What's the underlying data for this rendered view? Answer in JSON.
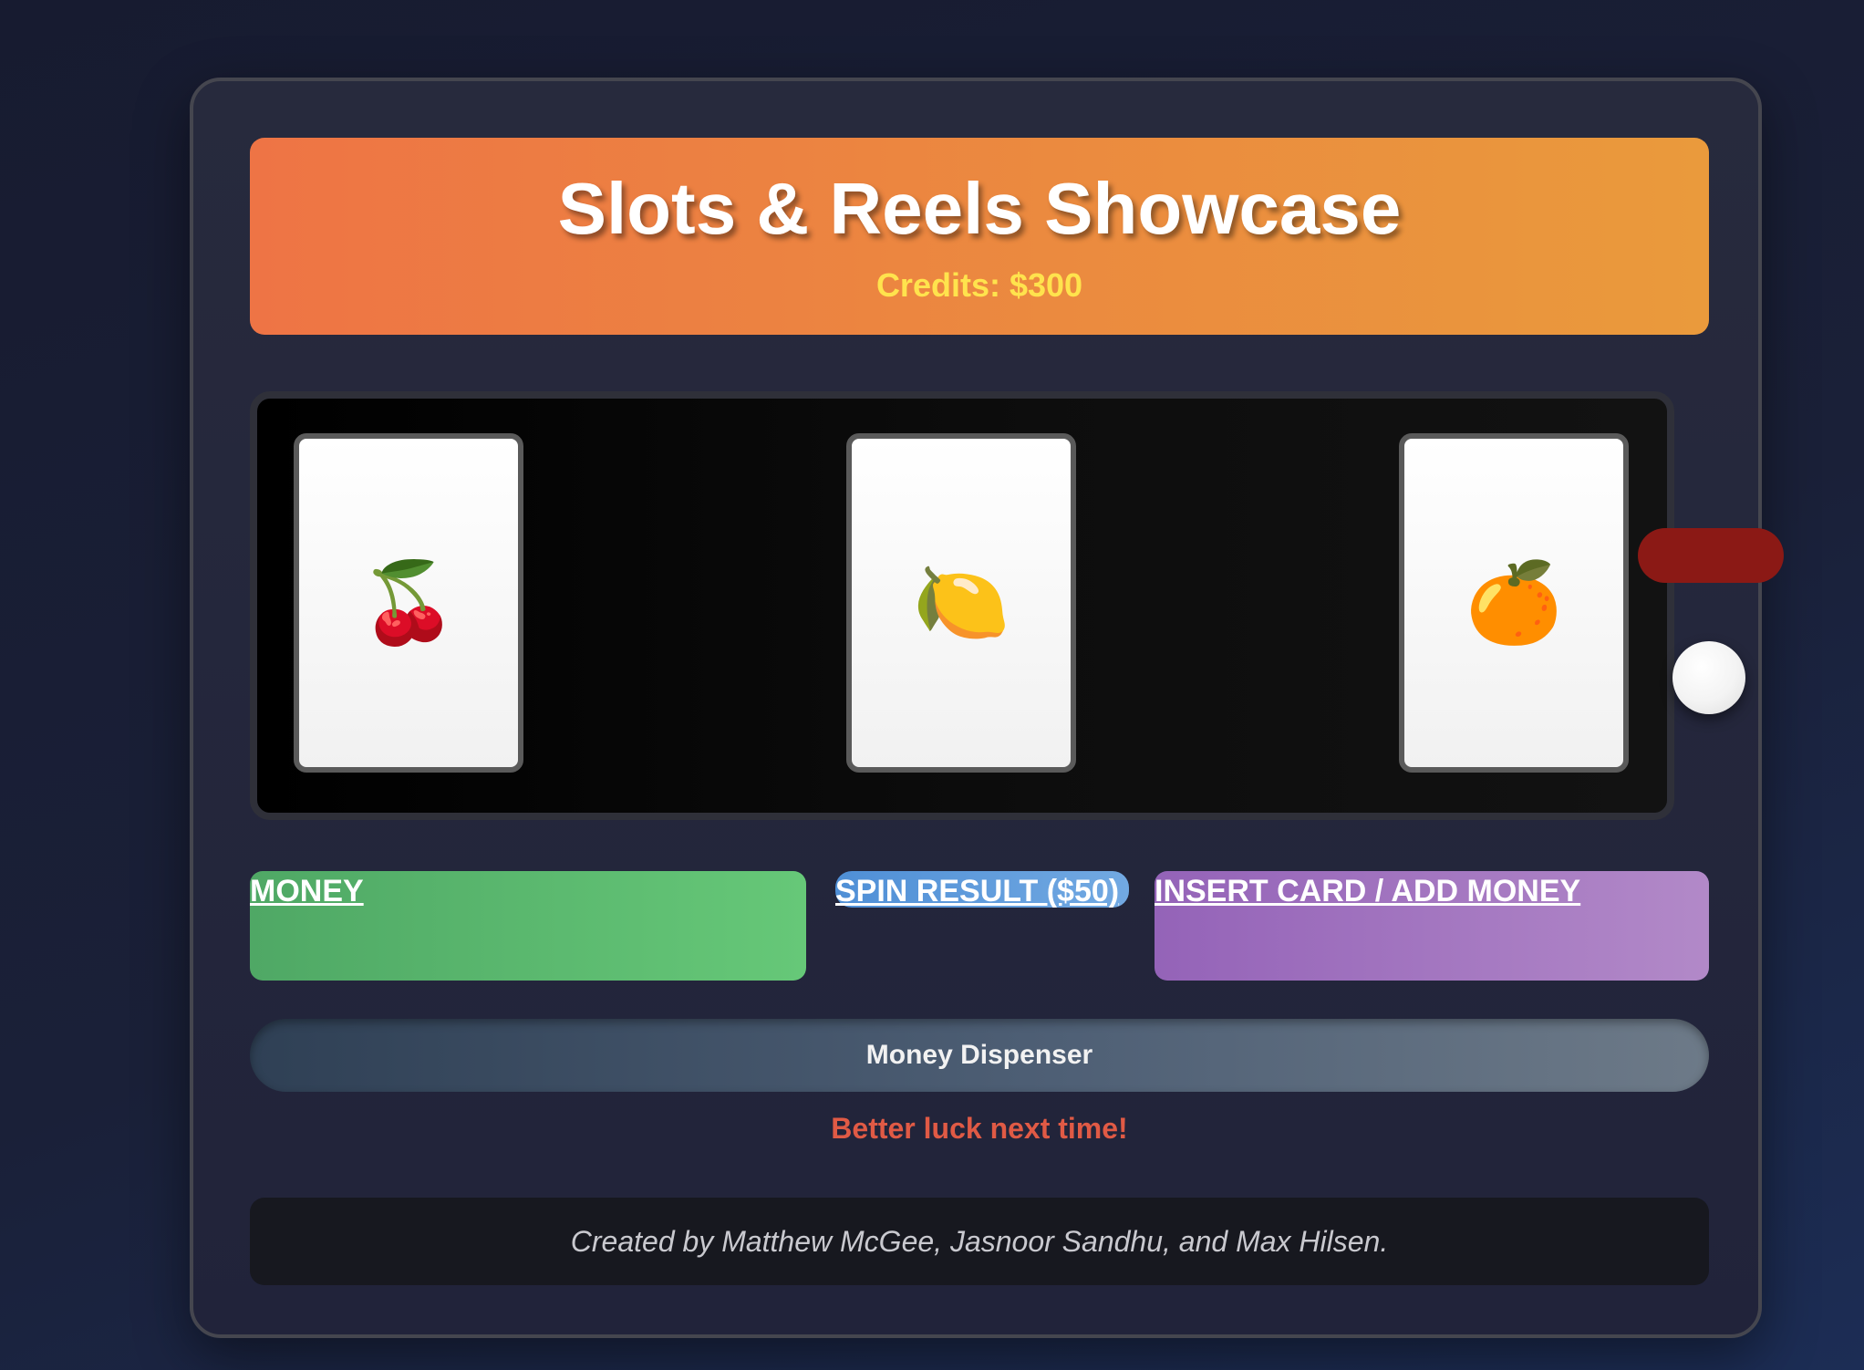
{
  "header": {
    "title": "Slots & Reels Showcase",
    "credits": "Credits: $300"
  },
  "reels": [
    {
      "symbol": "🍒",
      "icon": "cherry-icon"
    },
    {
      "symbol": "🍋",
      "icon": "lemon-icon"
    },
    {
      "symbol": "🍊",
      "icon": "orange-icon"
    }
  ],
  "buttons": {
    "money": "MONEY",
    "spin": "SPIN RESULT ($50)",
    "card": "INSERT CARD / ADD MONEY"
  },
  "dispenser": {
    "label": "Money Dispenser"
  },
  "status": {
    "message": "Better luck next time!"
  },
  "footer": {
    "credits_text": "Created by Matthew McGee, Jasnoor Sandhu, and Max Hilsen."
  },
  "colors": {
    "header_accent": "#ee7445",
    "credits_text": "#ffe34d",
    "money_button": "#5cb86f",
    "spin_button": "#5f9ddc",
    "card_button": "#a276c0",
    "lever": "#8b1915",
    "status_lose": "#e05a45"
  }
}
